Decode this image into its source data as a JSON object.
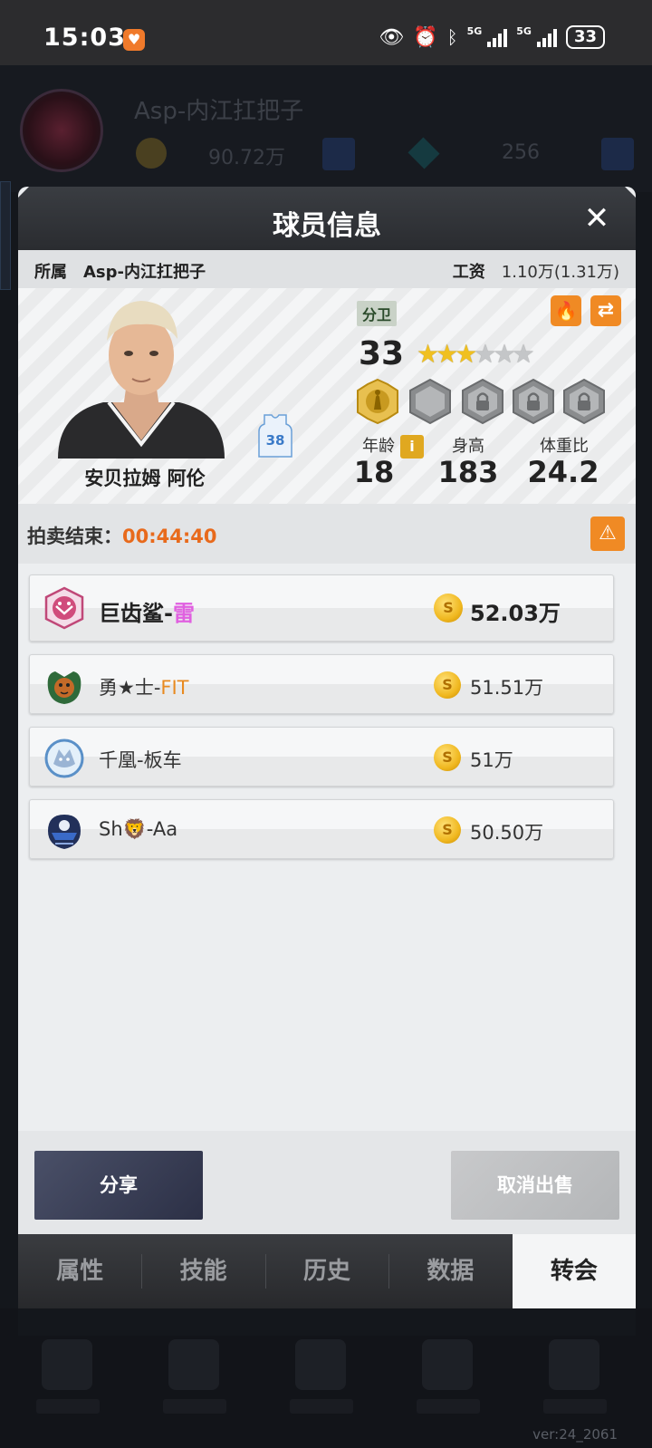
{
  "status_bar": {
    "time": "15:03",
    "battery": "33",
    "network_1": "5G",
    "network_2": "5G"
  },
  "background": {
    "team_name": "Asp-内江扛把子",
    "coins": "90.72万",
    "gems": "256",
    "version": "ver:24_2061"
  },
  "modal": {
    "title": "球员信息",
    "close_icon": "close-icon",
    "affiliation_label": "所属",
    "affiliation_team": "Asp-内江扛把子",
    "salary_label": "工资",
    "salary_value": "1.10万(1.31万)"
  },
  "player": {
    "name": "安贝拉姆 阿伦",
    "jersey_number": "38",
    "position": "分卫",
    "rating": "33",
    "stars_filled": 3,
    "stars_total": 6,
    "age_label": "年龄",
    "age": "18",
    "height_label": "身高",
    "height": "183",
    "weight_label": "体重比",
    "weight_ratio": "24.2",
    "info_icon": "i"
  },
  "auction": {
    "label": "拍卖结束：",
    "time_left": "00:44:40"
  },
  "bids": [
    {
      "team": "巨齿鲨-",
      "suffix": "雷",
      "amount": "52.03万",
      "logo": "shark-logo"
    },
    {
      "team": "勇★士-",
      "suffix": "FIT",
      "amount": "51.51万",
      "logo": "tiger-logo"
    },
    {
      "team": "千凰-板车",
      "suffix": "",
      "amount": "51万",
      "logo": "wolf-logo"
    },
    {
      "team": "Sh🦁-Aa",
      "suffix": "",
      "amount": "50.50万",
      "logo": "shield-logo"
    }
  ],
  "coin_glyph": "S",
  "footer": {
    "share_label": "分享",
    "cancel_sale_label": "取消出售"
  },
  "tabs": [
    {
      "label": "属性",
      "active": false
    },
    {
      "label": "技能",
      "active": false
    },
    {
      "label": "历史",
      "active": false
    },
    {
      "label": "数据",
      "active": false
    },
    {
      "label": "转会",
      "active": true
    }
  ],
  "colors": {
    "accent_orange": "#f08a24",
    "timer_orange": "#e86a1c",
    "star_gold": "#f0c020"
  }
}
